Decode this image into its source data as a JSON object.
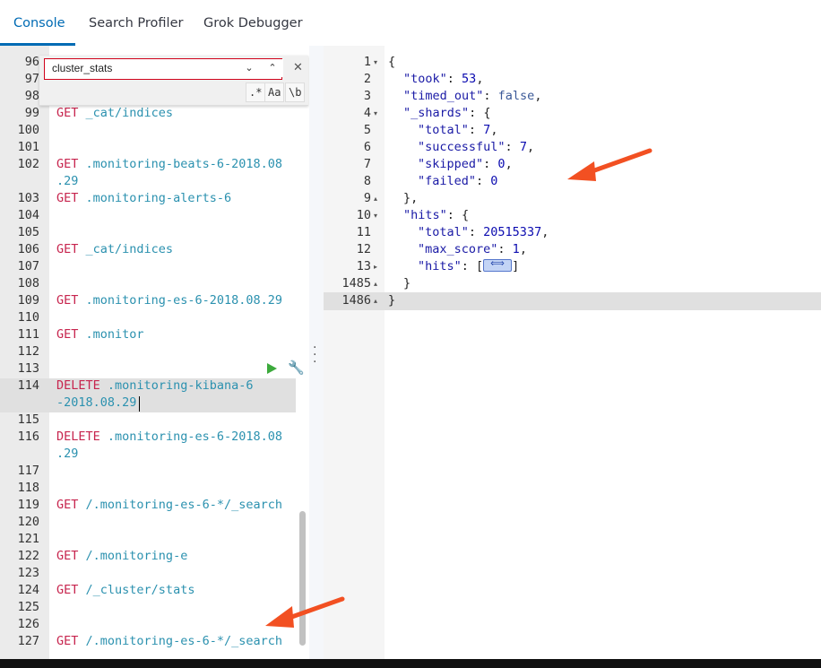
{
  "tabs": [
    {
      "label": "Console",
      "active": true
    },
    {
      "label": "Search Profiler",
      "active": false
    },
    {
      "label": "Grok Debugger",
      "active": false
    }
  ],
  "search": {
    "value": "cluster_stats",
    "next_icon": "chevron-down-icon",
    "prev_icon": "chevron-up-icon",
    "close_icon": "close-icon",
    "options": [
      ".*",
      "Aa",
      "\\b"
    ]
  },
  "left_lines": [
    {
      "n": "96"
    },
    {
      "n": "97"
    },
    {
      "n": "98"
    },
    {
      "n": "99",
      "method": "GET",
      "path": "_cat/indices"
    },
    {
      "n": "100"
    },
    {
      "n": "101"
    },
    {
      "n": "102",
      "method": "GET",
      "path": ".monitoring-beats-6-2018.08",
      "cont": ".29"
    },
    {
      "n": "103",
      "method": "GET",
      "path": ".monitoring-alerts-6"
    },
    {
      "n": "104"
    },
    {
      "n": "105"
    },
    {
      "n": "106",
      "method": "GET",
      "path": "_cat/indices"
    },
    {
      "n": "107"
    },
    {
      "n": "108"
    },
    {
      "n": "109",
      "method": "GET",
      "path": ".monitoring-es-6-2018.08.29"
    },
    {
      "n": "110"
    },
    {
      "n": "111",
      "method": "GET",
      "path": ".monitor"
    },
    {
      "n": "112"
    },
    {
      "n": "113"
    },
    {
      "n": "114",
      "method": "DELETE",
      "path": ".monitoring-kibana-6",
      "cont": "-2018.08.29"
    },
    {
      "n": "115"
    },
    {
      "n": "116",
      "method": "DELETE",
      "path": ".monitoring-es-6-2018.08",
      "cont": ".29"
    },
    {
      "n": "117"
    },
    {
      "n": "118"
    },
    {
      "n": "119",
      "method": "GET",
      "path": "/.monitoring-es-6-*/_search"
    },
    {
      "n": "120"
    },
    {
      "n": "121"
    },
    {
      "n": "122",
      "method": "GET",
      "path": "/.monitoring-e"
    },
    {
      "n": "123"
    },
    {
      "n": "124",
      "method": "GET",
      "path": "/_cluster/stats"
    },
    {
      "n": "125"
    },
    {
      "n": "126"
    },
    {
      "n": "127",
      "method": "GET",
      "path": "/.monitoring-es-6-*/_search"
    }
  ],
  "response": {
    "line_numbers": [
      "1",
      "2",
      "3",
      "4",
      "5",
      "6",
      "7",
      "8",
      "9",
      "10",
      "11",
      "12",
      "13",
      "1485",
      "1486"
    ],
    "took_key": "\"took\"",
    "took": "53",
    "timed_out_key": "\"timed_out\"",
    "timed_out": "false",
    "shards_key": "\"_shards\"",
    "total_key": "\"total\"",
    "shards_total": "7",
    "successful_key": "\"successful\"",
    "successful": "7",
    "skipped_key": "\"skipped\"",
    "skipped": "0",
    "failed_key": "\"failed\"",
    "failed": "0",
    "hits_key": "\"hits\"",
    "hits_total": "20515337",
    "max_score_key": "\"max_score\"",
    "max_score": "1"
  },
  "colors": {
    "accent": "#006bb4",
    "method": "#c7254e",
    "path": "#2b91af",
    "annotation_arrow": "#f25022"
  }
}
